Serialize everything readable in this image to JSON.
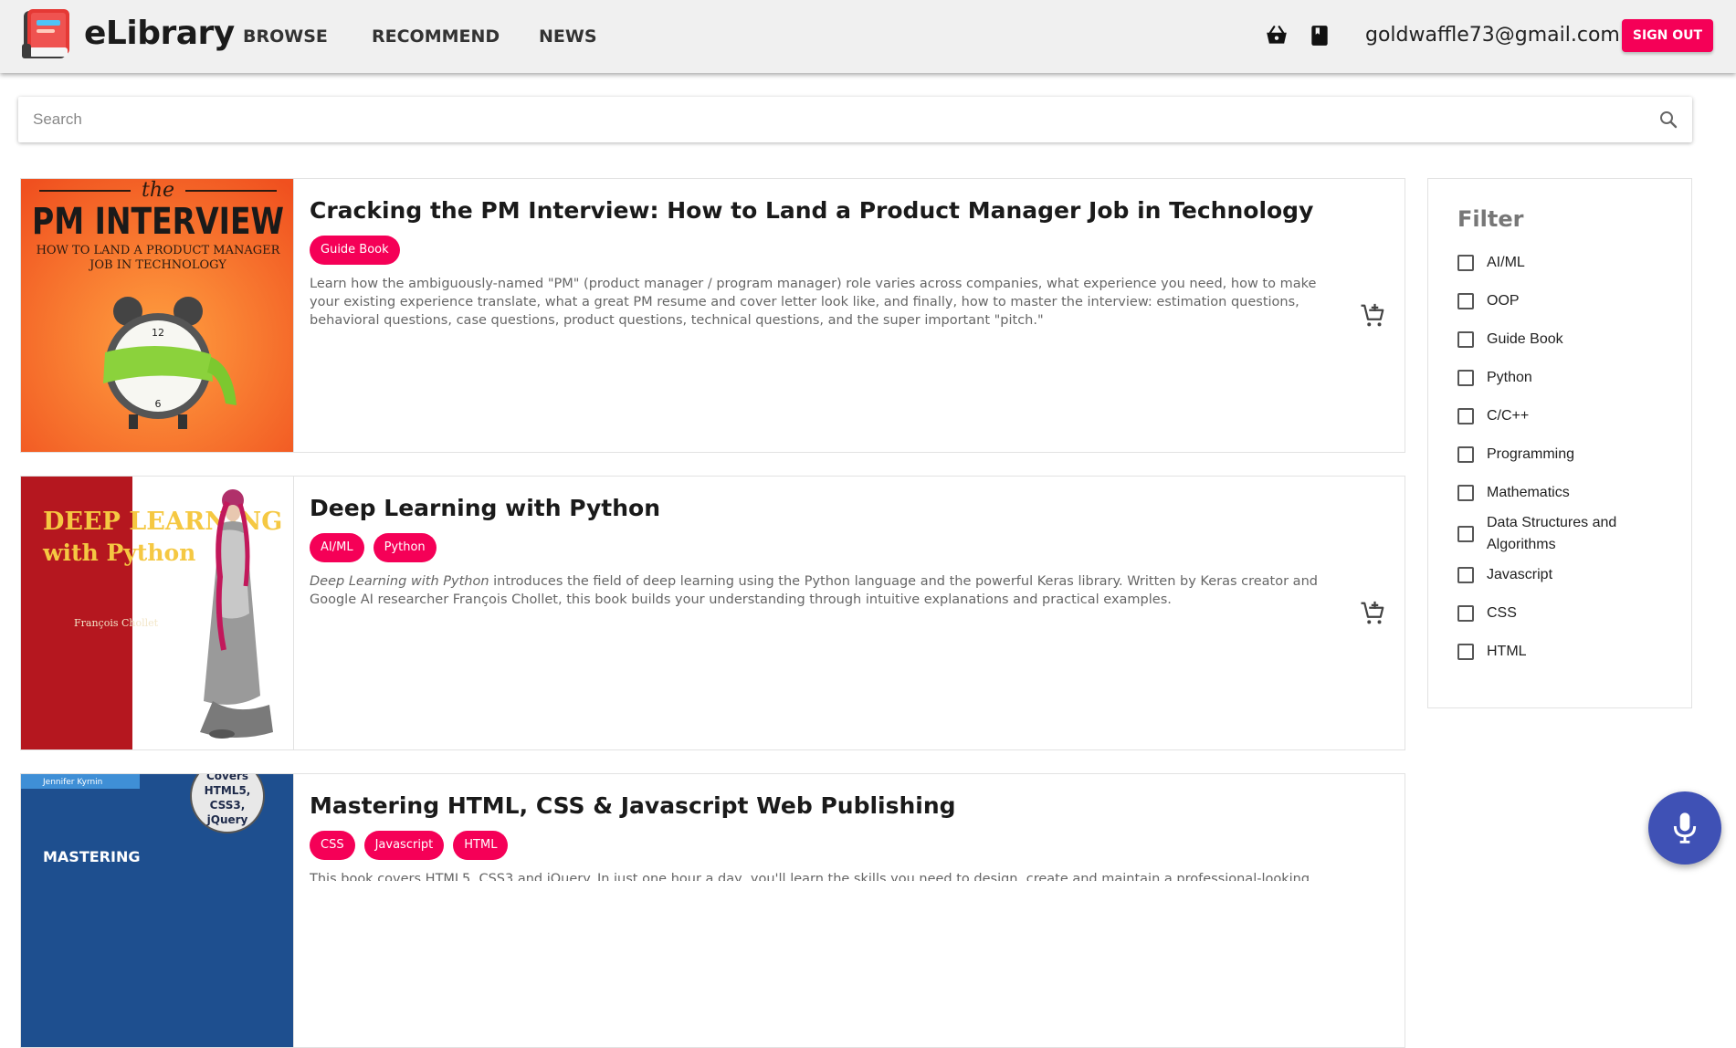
{
  "app": {
    "name": "eLibrary"
  },
  "nav": [
    {
      "label": "BROWSE"
    },
    {
      "label": "RECOMMEND"
    },
    {
      "label": "NEWS"
    }
  ],
  "header": {
    "user_email": "goldwaffle73@gmail.com",
    "signout_label": "SIGN OUT",
    "icons": [
      "basket-icon",
      "book-icon"
    ]
  },
  "search": {
    "placeholder": "Search",
    "value": ""
  },
  "books": [
    {
      "title": "Cracking the PM Interview: How to Land a Product Manager Job in Technology",
      "tags": [
        "Guide Book"
      ],
      "description": "Learn how the ambiguously-named \"PM\" (product manager / program manager) role varies across companies, what experience you need, how to make your existing experience translate, what a great PM resume and cover letter look like, and finally, how to master the interview: estimation questions, behavioral questions, case questions, product questions, technical questions, and the super important \"pitch.\"",
      "cover": {
        "line1": "the",
        "line2": "PM INTERVIEW",
        "line3": "HOW TO LAND A PRODUCT MANAGER",
        "line4": "JOB IN TECHNOLOGY",
        "bg": "#f26a2a"
      }
    },
    {
      "title": "Deep Learning with Python",
      "tags": [
        "AI/ML",
        "Python"
      ],
      "description_emphasis": "Deep Learning with Python",
      "description": " introduces the field of deep learning using the Python language and the powerful Keras library. Written by Keras creator and Google AI researcher François Chollet, this book builds your understanding through intuitive explanations and practical examples.",
      "cover": {
        "line1": "DEEP LEARNING",
        "line2": "with Python",
        "author": "François Chollet",
        "bg": "#b5171f"
      }
    },
    {
      "title": "Mastering HTML, CSS & Javascript Web Publishing",
      "tags": [
        "CSS",
        "Javascript",
        "HTML"
      ],
      "description": "This book covers HTML5, CSS3 and jQuery. In just one hour a day, you'll learn the skills you need to design, create and maintain a professional-looking",
      "cover": {
        "author": "Jennifer Kyrnin",
        "badge1": "Covers",
        "badge2": "HTML5,",
        "badge3": "CSS3,",
        "badge4": "jQuery",
        "line1": "MASTERING",
        "bg": "#1e4f8f"
      }
    }
  ],
  "filter": {
    "title": "Filter",
    "options": [
      {
        "label": "AI/ML",
        "checked": false
      },
      {
        "label": "OOP",
        "checked": false
      },
      {
        "label": "Guide Book",
        "checked": false
      },
      {
        "label": "Python",
        "checked": false
      },
      {
        "label": "C/C++",
        "checked": false
      },
      {
        "label": "Programming",
        "checked": false
      },
      {
        "label": "Mathematics",
        "checked": false
      },
      {
        "label": "Data Structures and Algorithms",
        "checked": false
      },
      {
        "label": "Javascript",
        "checked": false
      },
      {
        "label": "CSS",
        "checked": false
      },
      {
        "label": "HTML",
        "checked": false
      }
    ]
  },
  "colors": {
    "accent": "#f50057",
    "fab": "#3f51b5",
    "header_bg": "#f0f0f0"
  }
}
